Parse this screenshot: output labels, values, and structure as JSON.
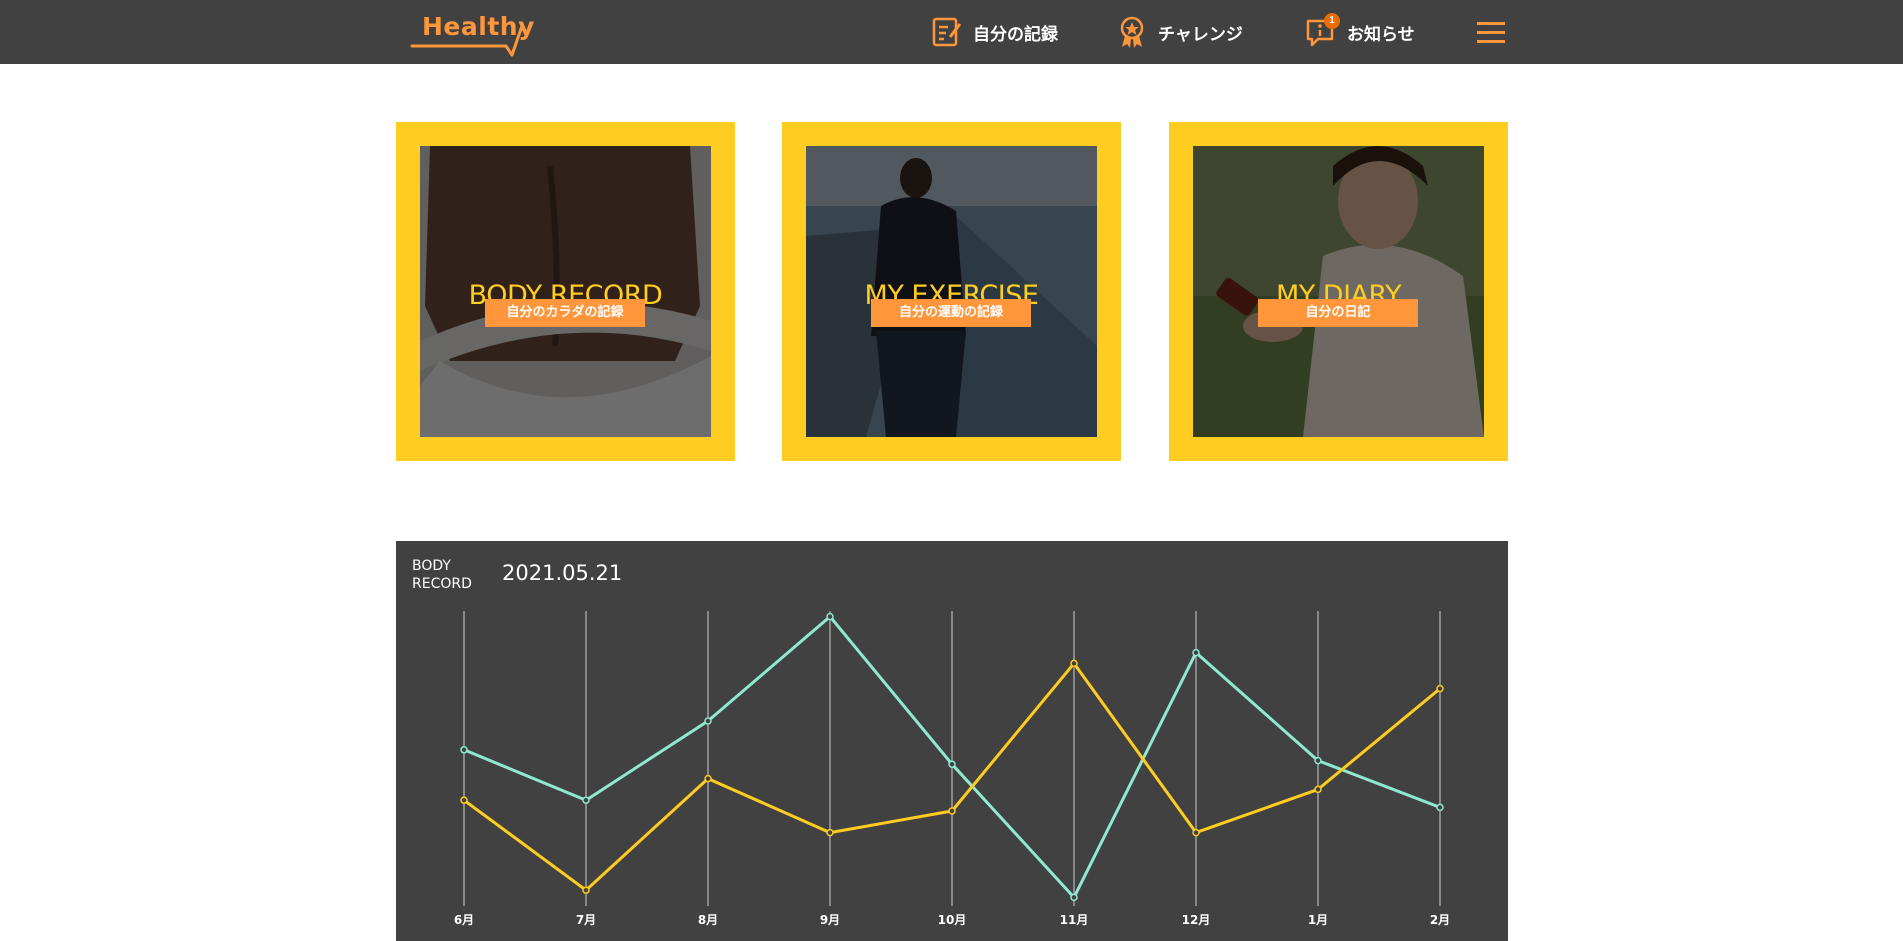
{
  "header": {
    "logo_text": "Healthy",
    "nav": [
      {
        "label": "自分の記録",
        "icon": "memo-icon"
      },
      {
        "label": "チャレンジ",
        "icon": "challenge-medal-icon"
      },
      {
        "label": "お知らせ",
        "icon": "info-notification-icon",
        "badge": "1"
      }
    ],
    "menu_icon": "hamburger-menu-icon"
  },
  "cards": [
    {
      "title": "BODY RECORD",
      "subtitle": "自分のカラダの記録"
    },
    {
      "title": "MY EXERCISE",
      "subtitle": "自分の運動の記録"
    },
    {
      "title": "MY DIARY",
      "subtitle": "自分の日記"
    }
  ],
  "graph": {
    "label_line1": "BODY",
    "label_line2": "RECORD",
    "date": "2021.05.21"
  },
  "colors": {
    "header_bg": "#414141",
    "accent_orange": "#FF963C",
    "accent_yellow": "#FFCC21",
    "line_teal": "#8FE9D0"
  },
  "chart_data": {
    "type": "line",
    "categories": [
      "6月",
      "7月",
      "8月",
      "9月",
      "10月",
      "11月",
      "12月",
      "1月",
      "2月"
    ],
    "series": [
      {
        "values": [
          62,
          48,
          70,
          99,
          58,
          21,
          89,
          59,
          46
        ]
      },
      {
        "values": [
          48,
          23,
          54,
          39,
          45,
          86,
          39,
          51,
          79
        ]
      }
    ],
    "ylim": [
      20,
      100
    ],
    "grid": "vertical",
    "legend": "none"
  }
}
